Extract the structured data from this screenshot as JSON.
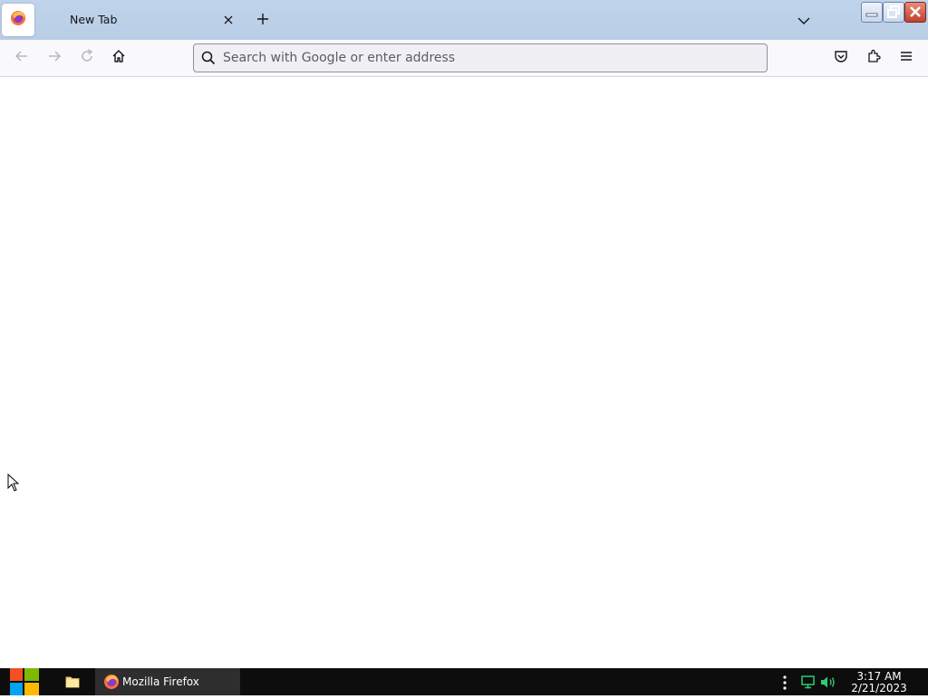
{
  "browser": {
    "tab": {
      "title": "New Tab"
    },
    "urlbar": {
      "placeholder": "Search with Google or enter address",
      "value": ""
    }
  },
  "taskbar": {
    "apps": [
      {
        "label": "Mozilla Firefox"
      }
    ],
    "clock": {
      "time": "3:17 AM",
      "date": "2/21/2023"
    }
  },
  "icons": {
    "tab_favicon": "firefox-icon",
    "tab_close": "close-icon",
    "new_tab": "plus-icon",
    "list_tabs": "chevron-down-icon",
    "back": "back-arrow-icon",
    "forward": "forward-arrow-icon",
    "reload": "reload-icon",
    "home": "home-icon",
    "search": "search-icon",
    "pocket": "pocket-icon",
    "extensions": "puzzle-icon",
    "menu": "hamburger-menu-icon"
  },
  "colors": {
    "tabbar_bg": "#bfd3ea",
    "toolbar_bg": "#f9f9fb",
    "urlbar_bg": "#f0f0f4",
    "taskbar_bg": "#0d0d0d",
    "tray_green": "#2ecc71"
  }
}
